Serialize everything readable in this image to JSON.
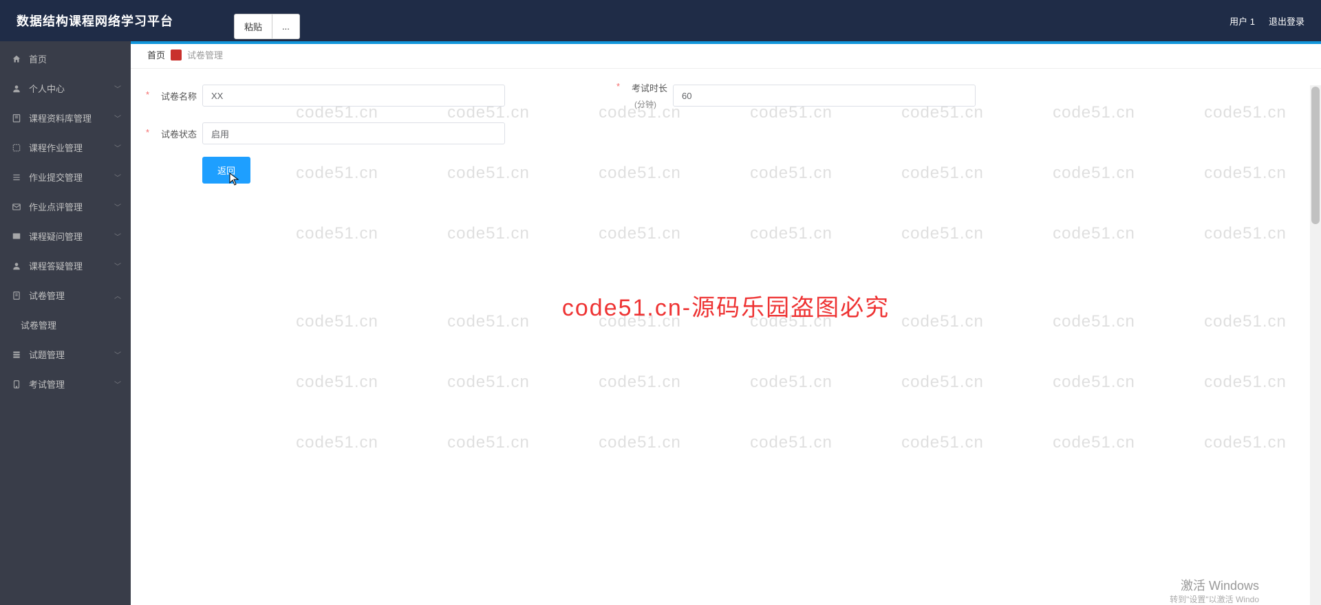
{
  "header": {
    "title": "数据结构课程网络学习平台",
    "paste_label": "粘贴",
    "paste_more": "...",
    "user_label": "用户 1",
    "logout_label": "退出登录"
  },
  "sidebar": {
    "items": [
      {
        "label": "首页",
        "icon": "home-icon",
        "expandable": false
      },
      {
        "label": "个人中心",
        "icon": "user-icon",
        "expandable": true
      },
      {
        "label": "课程资料库管理",
        "icon": "book-icon",
        "expandable": true
      },
      {
        "label": "课程作业管理",
        "icon": "task-icon",
        "expandable": true
      },
      {
        "label": "作业提交管理",
        "icon": "list-icon",
        "expandable": true
      },
      {
        "label": "作业点评管理",
        "icon": "mail-icon",
        "expandable": true
      },
      {
        "label": "课程疑问管理",
        "icon": "question-icon",
        "expandable": true
      },
      {
        "label": "课程答疑管理",
        "icon": "answer-icon",
        "expandable": true
      },
      {
        "label": "试卷管理",
        "icon": "paper-icon",
        "expandable": true,
        "expanded": true,
        "children": [
          {
            "label": "试卷管理"
          }
        ]
      },
      {
        "label": "试题管理",
        "icon": "item-icon",
        "expandable": true
      },
      {
        "label": "考试管理",
        "icon": "exam-icon",
        "expandable": true
      }
    ]
  },
  "breadcrumb": {
    "home": "首页",
    "current": "试卷管理"
  },
  "form": {
    "name_label": "试卷名称",
    "name_value": "XX",
    "duration_label": "考试时长",
    "duration_value": "60",
    "duration_unit": "(分钟)",
    "status_label": "试卷状态",
    "status_value": "启用",
    "back_btn": "返回"
  },
  "watermark": {
    "text": "code51.cn",
    "banner": "code51.cn-源码乐园盗图必究"
  },
  "windows": {
    "activate": "激活 Windows",
    "sub": "转到\"设置\"以激活 Windo"
  }
}
